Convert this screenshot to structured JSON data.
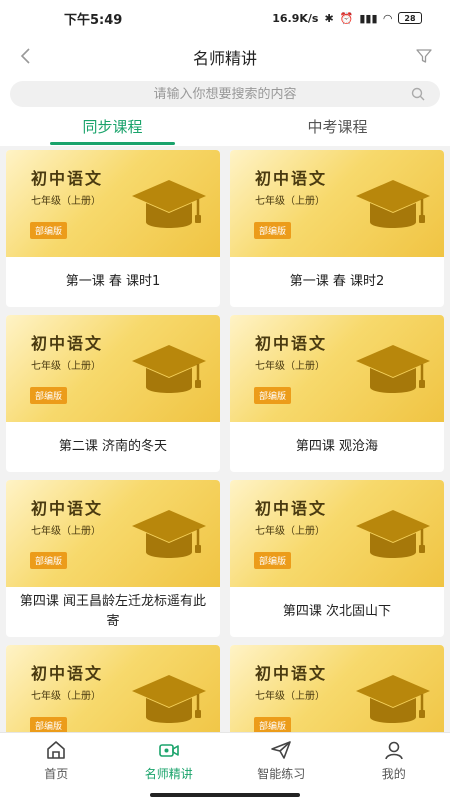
{
  "status": {
    "time": "下午5:49",
    "net_speed": "16.9K/s",
    "battery": "28"
  },
  "nav": {
    "title": "名师精讲"
  },
  "search": {
    "placeholder": "请输入你想要搜索的内容"
  },
  "tabs": [
    {
      "label": "同步课程",
      "active": true
    },
    {
      "label": "中考课程",
      "active": false
    }
  ],
  "cards": [
    {
      "cover_title": "初中语文",
      "cover_grade": "七年级（上册）",
      "badge": "部编版",
      "title": "第一课 春 课时1"
    },
    {
      "cover_title": "初中语文",
      "cover_grade": "七年级（上册）",
      "badge": "部编版",
      "title": "第一课 春 课时2"
    },
    {
      "cover_title": "初中语文",
      "cover_grade": "七年级（上册）",
      "badge": "部编版",
      "title": "第二课 济南的冬天"
    },
    {
      "cover_title": "初中语文",
      "cover_grade": "七年级（上册）",
      "badge": "部编版",
      "title": "第四课 观沧海"
    },
    {
      "cover_title": "初中语文",
      "cover_grade": "七年级（上册）",
      "badge": "部编版",
      "title": "第四课 闻王昌龄左迁龙标遥有此寄"
    },
    {
      "cover_title": "初中语文",
      "cover_grade": "七年级（上册）",
      "badge": "部编版",
      "title": "第四课 次北固山下"
    },
    {
      "cover_title": "初中语文",
      "cover_grade": "七年级（上册）",
      "badge": "部编版",
      "title": ""
    },
    {
      "cover_title": "初中语文",
      "cover_grade": "七年级（上册）",
      "badge": "部编版",
      "title": ""
    }
  ],
  "bottom_nav": [
    {
      "label": "首页",
      "icon": "home-icon",
      "active": false
    },
    {
      "label": "名师精讲",
      "icon": "video-icon",
      "active": true
    },
    {
      "label": "智能练习",
      "icon": "paper-plane-icon",
      "active": false
    },
    {
      "label": "我的",
      "icon": "user-icon",
      "active": false
    }
  ],
  "colors": {
    "accent": "#1aa36b",
    "badge": "#ec9c1a",
    "cap": "#b8870c"
  }
}
